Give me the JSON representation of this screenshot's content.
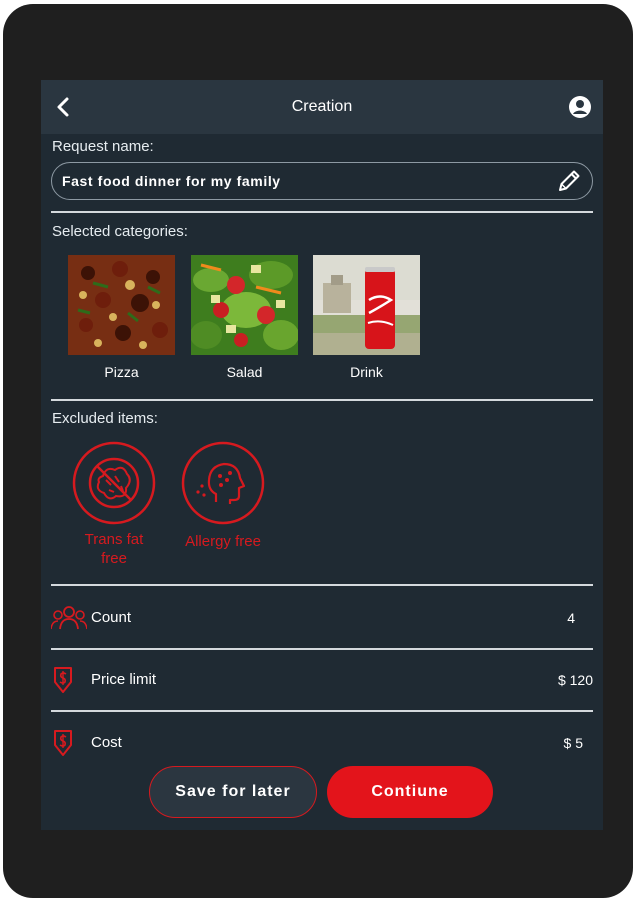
{
  "header": {
    "title": "Creation",
    "back_icon": "chevron-left-icon",
    "account_icon": "account-circle-icon"
  },
  "request": {
    "label": "Request name:",
    "value": "Fast food dinner for my family",
    "edit_icon": "pencil-icon"
  },
  "categories": {
    "label": "Selected categories:",
    "items": [
      {
        "label": "Pizza",
        "icon": "pizza-image"
      },
      {
        "label": "Salad",
        "icon": "salad-image"
      },
      {
        "label": "Drink",
        "icon": "cola-can-image"
      }
    ]
  },
  "excluded": {
    "label": "Excluded items:",
    "items": [
      {
        "label": "Trans fat free",
        "icon": "no-trans-fat-icon"
      },
      {
        "label": "Allergy free",
        "icon": "allergy-icon"
      }
    ]
  },
  "details": {
    "count": {
      "label": "Count",
      "value": "4",
      "icon": "people-icon"
    },
    "price_limit": {
      "label": "Price limit",
      "value": "$ 120",
      "icon": "price-tag-icon"
    },
    "cost": {
      "label": "Cost",
      "value": "$ 5",
      "icon": "price-tag-icon"
    }
  },
  "actions": {
    "save_label": "Save for later",
    "continue_label": "Contiune"
  },
  "colors": {
    "accent": "#e3141b",
    "background": "#1f2a33",
    "topbar": "#2a3640"
  }
}
